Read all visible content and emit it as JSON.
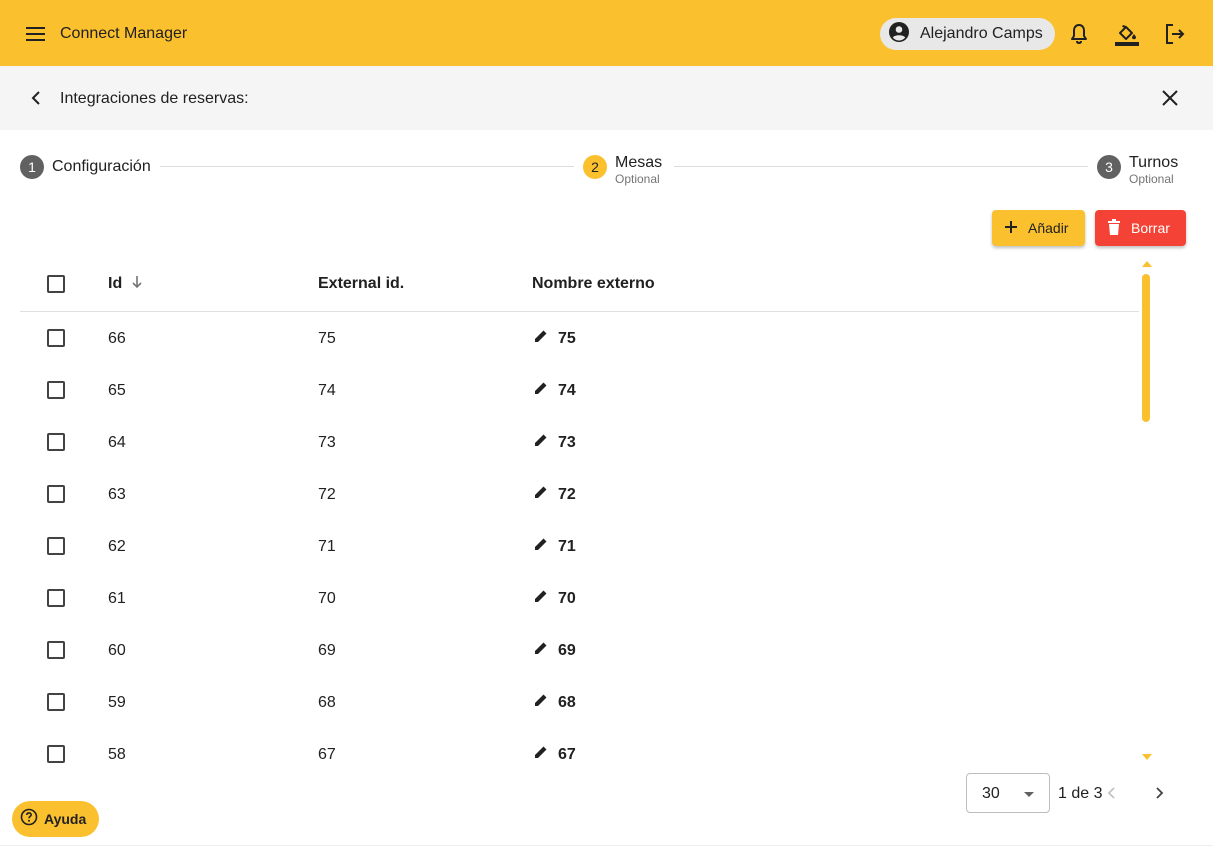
{
  "app": {
    "title": "Connect Manager"
  },
  "user": {
    "name": "Alejandro Camps"
  },
  "subheader": {
    "title": "Integraciones de reservas: "
  },
  "stepper": [
    {
      "number": "1",
      "label": "Configuración",
      "optional": "",
      "state": "inactive"
    },
    {
      "number": "2",
      "label": "Mesas",
      "optional": "Optional",
      "state": "active"
    },
    {
      "number": "3",
      "label": "Turnos",
      "optional": "Optional",
      "state": "inactive"
    }
  ],
  "actions": {
    "add_label": "Añadir",
    "delete_label": "Borrar"
  },
  "table": {
    "columns": {
      "id": "Id",
      "external_id": "External id.",
      "name": "Nombre externo"
    },
    "sort": {
      "column": "Id",
      "direction": "desc"
    },
    "rows": [
      {
        "id": "66",
        "external_id": "75",
        "name": "75"
      },
      {
        "id": "65",
        "external_id": "74",
        "name": "74"
      },
      {
        "id": "64",
        "external_id": "73",
        "name": "73"
      },
      {
        "id": "63",
        "external_id": "72",
        "name": "72"
      },
      {
        "id": "62",
        "external_id": "71",
        "name": "71"
      },
      {
        "id": "61",
        "external_id": "70",
        "name": "70"
      },
      {
        "id": "60",
        "external_id": "69",
        "name": "69"
      },
      {
        "id": "59",
        "external_id": "68",
        "name": "68"
      },
      {
        "id": "58",
        "external_id": "67",
        "name": "67"
      }
    ]
  },
  "pagination": {
    "page_size": "30",
    "page_info": "1 de 3"
  },
  "help": {
    "label": "Ayuda"
  },
  "colors": {
    "primary": "#fbc02d",
    "danger": "#f44336",
    "subheader_bg": "#f5f5f5"
  }
}
